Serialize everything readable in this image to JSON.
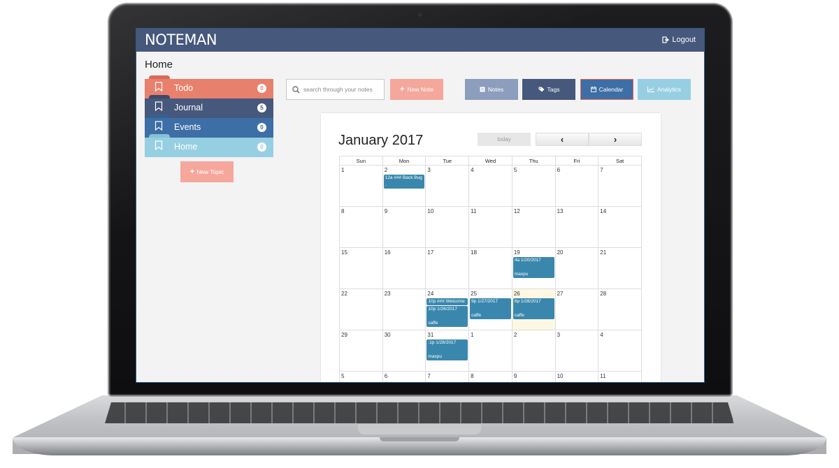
{
  "app": {
    "brand": "NOTEMAN",
    "logout_label": "Logout"
  },
  "page": {
    "heading": "Home"
  },
  "topics": [
    {
      "label": "Todo",
      "count": "0",
      "color": "#e8806e",
      "tab": "#d96a57"
    },
    {
      "label": "Journal",
      "count": "5",
      "color": "#46587b",
      "tab": "#3b4a69"
    },
    {
      "label": "Events",
      "count": "0",
      "color": "#3d6ea6",
      "tab": "#356192"
    },
    {
      "label": "Home",
      "count": "0",
      "color": "#97cfe2",
      "tab": "#84c2d7"
    }
  ],
  "sidebar": {
    "new_topic_label": "New Topic"
  },
  "toolbar": {
    "search_placeholder": "search through your notes",
    "new_note_label": "New Note",
    "notes_label": "Notes",
    "tags_label": "Tags",
    "calendar_label": "Calendar",
    "analytics_label": "Analytics"
  },
  "calendar": {
    "title": "January 2017",
    "today_label": "today",
    "prev_label": "‹",
    "next_label": "›",
    "days_of_week": [
      "Sun",
      "Mon",
      "Tue",
      "Wed",
      "Thu",
      "Fri",
      "Sat"
    ],
    "today_date": "26",
    "weeks": [
      [
        {
          "d": "1"
        },
        {
          "d": "2",
          "events": [
            "12a ### Back Bug\n."
          ]
        },
        {
          "d": "3"
        },
        {
          "d": "4"
        },
        {
          "d": "5"
        },
        {
          "d": "6"
        },
        {
          "d": "7"
        }
      ],
      [
        {
          "d": "8"
        },
        {
          "d": "9"
        },
        {
          "d": "10"
        },
        {
          "d": "11"
        },
        {
          "d": "12"
        },
        {
          "d": "13"
        },
        {
          "d": "14"
        }
      ],
      [
        {
          "d": "15"
        },
        {
          "d": "16"
        },
        {
          "d": "17"
        },
        {
          "d": "18"
        },
        {
          "d": "19",
          "events": [
            "4a 1/20/2017\n\nmaxpu"
          ]
        },
        {
          "d": "20"
        },
        {
          "d": "21"
        }
      ],
      [
        {
          "d": "22"
        },
        {
          "d": "23"
        },
        {
          "d": "24",
          "events": [
            "10p ### Welcome",
            "10p 1/26/2017\n\ncaffe"
          ]
        },
        {
          "d": "25",
          "events": [
            "9p 1/27/2017\n\ncaffe"
          ]
        },
        {
          "d": "26",
          "events": [
            "8p 1/28/2017\n\ncaffe"
          ]
        },
        {
          "d": "27"
        },
        {
          "d": "28"
        }
      ],
      [
        {
          "d": "29"
        },
        {
          "d": "30"
        },
        {
          "d": "31",
          "events": [
            ":1p 1/28/2017\n\nmaxpu"
          ]
        },
        {
          "d": "1"
        },
        {
          "d": "2"
        },
        {
          "d": "3"
        },
        {
          "d": "4"
        }
      ],
      [
        {
          "d": "5"
        },
        {
          "d": "6"
        },
        {
          "d": "7"
        },
        {
          "d": "8"
        },
        {
          "d": "9"
        },
        {
          "d": "10"
        },
        {
          "d": "11"
        }
      ]
    ]
  }
}
